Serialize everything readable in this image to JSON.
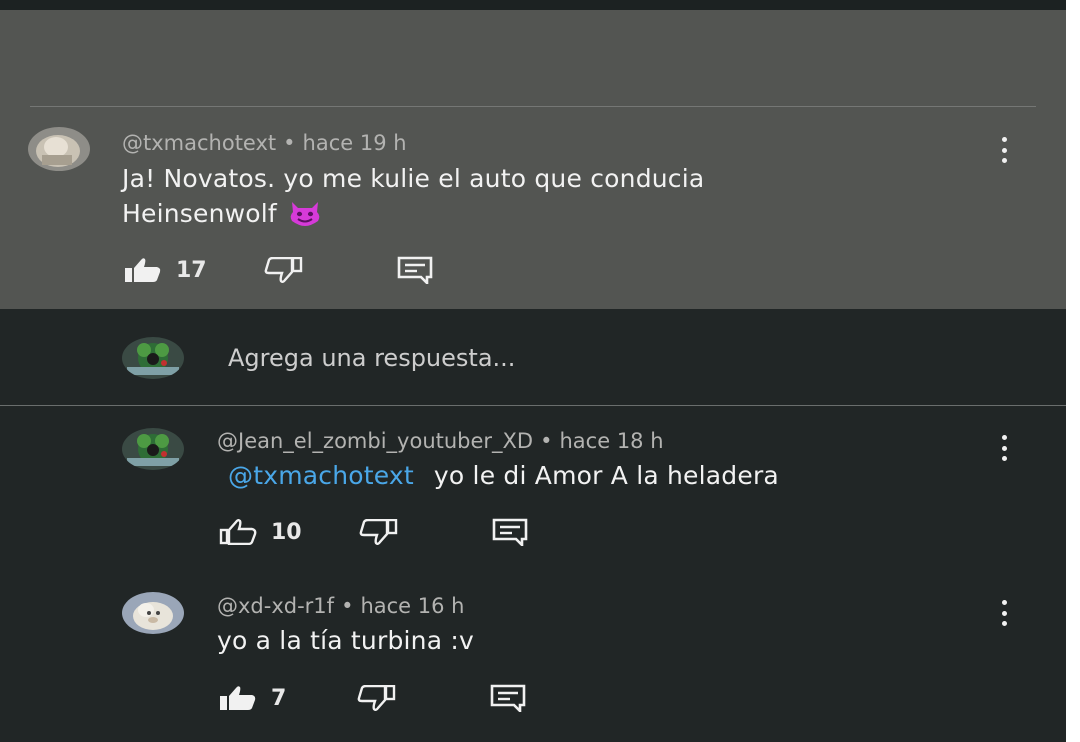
{
  "comment": {
    "author": "@txmachotext",
    "separator": "•",
    "time": "hace 19 h",
    "text": "Ja! Novatos. yo me kulie el auto que conducia",
    "text_line2": "Heinsenwolf",
    "emoji": "smiling-imp-emoji",
    "likes": "17"
  },
  "reply_box": {
    "placeholder": "Agrega una respuesta..."
  },
  "replies": [
    {
      "author": "@Jean_el_zombi_youtuber_XD",
      "separator": "•",
      "time": "hace 18 h",
      "mention": "@txmachotext",
      "text": "yo le di Amor A la heladera",
      "likes": "10"
    },
    {
      "author": "@xd-xd-r1f",
      "separator": "•",
      "time": "hace 16 h",
      "text": "yo a la tía turbina :v",
      "likes": "7"
    }
  ],
  "colors": {
    "background": "#212626",
    "highlight": "#535552",
    "mention": "#4aa7e8",
    "emoji": "#d63ad9"
  },
  "icons": [
    "like-icon",
    "dislike-icon",
    "reply-icon",
    "more-vert-icon"
  ]
}
